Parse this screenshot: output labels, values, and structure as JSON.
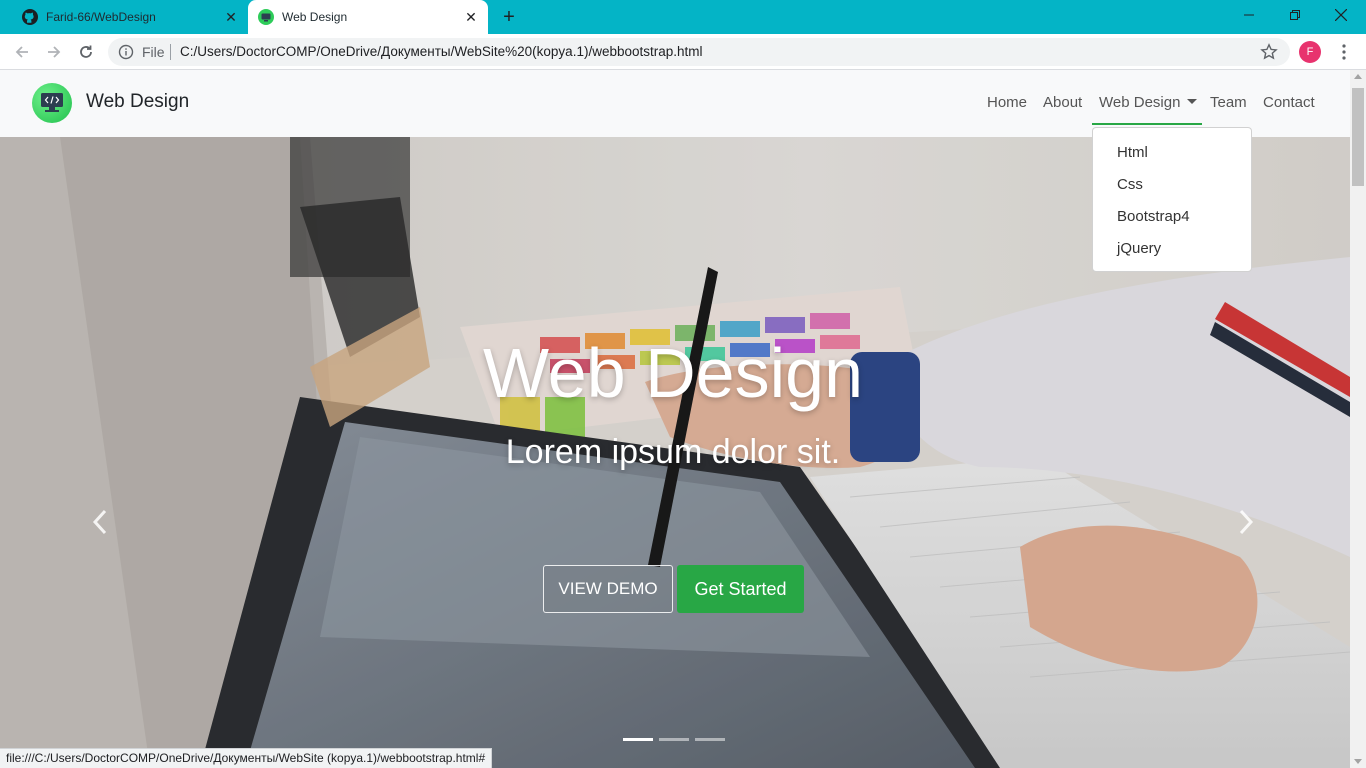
{
  "browser": {
    "tabs": [
      {
        "title": "Farid-66/WebDesign",
        "active": false,
        "icon": "github-icon"
      },
      {
        "title": "Web Design",
        "active": true,
        "icon": "site-favicon"
      }
    ],
    "address": {
      "scheme_label": "File",
      "url": "C:/Users/DoctorCOMP/OneDrive/Документы/WebSite%20(kopya.1)/webbootstrap.html"
    },
    "profile_initial": "F",
    "status_url": "file:///C:/Users/DoctorCOMP/OneDrive/Документы/WebSite (kopya.1)/webbootstrap.html#",
    "accent_color": "#04b4c6"
  },
  "site": {
    "brand": "Web Design",
    "nav": {
      "home": "Home",
      "about": "About",
      "web_design": "Web Design",
      "team": "Team",
      "contact": "Contact"
    },
    "dropdown": [
      "Html",
      "Css",
      "Bootstrap4",
      "jQuery"
    ],
    "hero": {
      "title": "Web Design",
      "subtitle": "Lorem ipsum dolor sit.",
      "demo_button": "VIEW DEMO",
      "start_button": "Get Started",
      "slide_count": 3,
      "active_slide": 1
    },
    "colors": {
      "primary_green": "#28a745",
      "navbar_bg": "#f8f9fa"
    }
  }
}
